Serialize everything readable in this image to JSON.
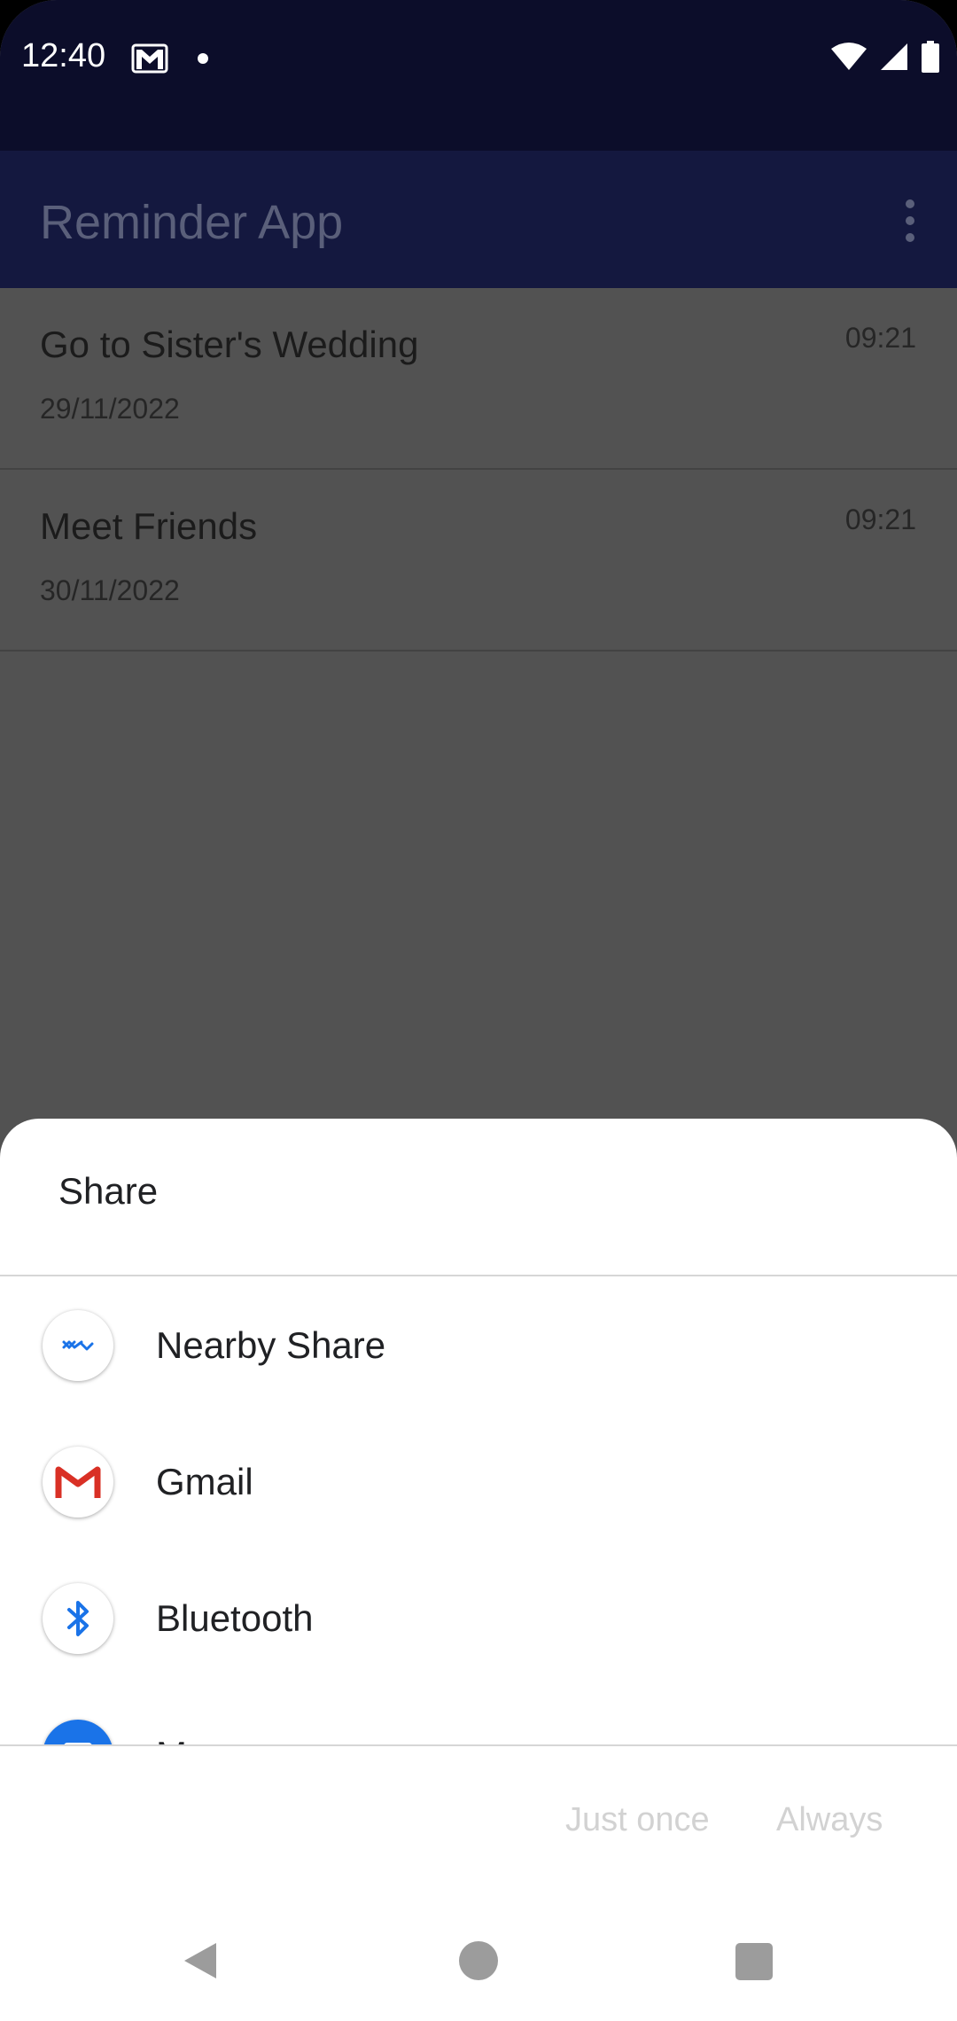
{
  "status_bar": {
    "time": "12:40",
    "icons": [
      "gmail-notification-icon",
      "notification-dot-icon",
      "wifi-icon",
      "cell-signal-icon",
      "battery-icon"
    ]
  },
  "app_bar": {
    "title": "Reminder App",
    "menu_icon": "more-vert-icon"
  },
  "reminders": [
    {
      "title": "Go to Sister's Wedding",
      "date": "29/11/2022",
      "time": "09:21"
    },
    {
      "title": "Meet Friends",
      "date": "30/11/2022",
      "time": "09:21"
    }
  ],
  "share_sheet": {
    "title": "Share",
    "targets": [
      {
        "label": "Nearby Share",
        "icon": "nearby-share-icon"
      },
      {
        "label": "Gmail",
        "icon": "gmail-icon"
      },
      {
        "label": "Bluetooth",
        "icon": "bluetooth-icon"
      },
      {
        "label": "Messages",
        "icon": "messages-icon"
      }
    ],
    "buttons": {
      "just_once": "Just once",
      "always": "Always"
    }
  },
  "nav_bar": {
    "icons": [
      "back-icon",
      "home-icon",
      "recents-icon"
    ]
  },
  "colors": {
    "status_bar": "#0c0d2a",
    "app_bar_dimmed": "#14183f",
    "scrim_background": "#525252",
    "sheet_background": "#ffffff",
    "accent_blue": "#1a73e8",
    "gmail_red": "#d93025"
  }
}
